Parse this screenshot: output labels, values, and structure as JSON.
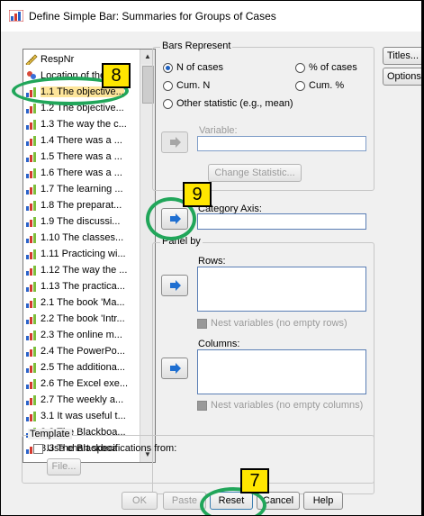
{
  "window": {
    "title": "Define Simple Bar: Summaries for Groups of Cases"
  },
  "variables": [
    {
      "label": "RespNr",
      "icon": "ruler-icon"
    },
    {
      "label": "Location of the st",
      "icon": "nominal-icon"
    },
    {
      "label": "1.1 The objective...",
      "icon": "bar-icon",
      "selected": true
    },
    {
      "label": "1.2 The objective...",
      "icon": "bar-icon"
    },
    {
      "label": "1.3 The way the c...",
      "icon": "bar-icon"
    },
    {
      "label": "1.4 There was a ...",
      "icon": "bar-icon"
    },
    {
      "label": "1.5 There was a ...",
      "icon": "bar-icon"
    },
    {
      "label": "1.6 There was a ...",
      "icon": "bar-icon"
    },
    {
      "label": "1.7 The learning ...",
      "icon": "bar-icon"
    },
    {
      "label": "1.8 The preparat...",
      "icon": "bar-icon"
    },
    {
      "label": "1.9 The discussi...",
      "icon": "bar-icon"
    },
    {
      "label": "1.10 The classes...",
      "icon": "bar-icon"
    },
    {
      "label": "1.11 Practicing wi...",
      "icon": "bar-icon"
    },
    {
      "label": "1.12 The way the ...",
      "icon": "bar-icon"
    },
    {
      "label": "1.13 The practica...",
      "icon": "bar-icon"
    },
    {
      "label": "2.1 The book 'Ma...",
      "icon": "bar-icon"
    },
    {
      "label": "2.2 The book 'Intr...",
      "icon": "bar-icon"
    },
    {
      "label": "2.3 The online m...",
      "icon": "bar-icon"
    },
    {
      "label": "2.4 The PowerPo...",
      "icon": "bar-icon"
    },
    {
      "label": "2.5 The additiona...",
      "icon": "bar-icon"
    },
    {
      "label": "2.6 The Excel exe...",
      "icon": "bar-icon"
    },
    {
      "label": "2.7 The weekly a...",
      "icon": "bar-icon"
    },
    {
      "label": "3.1 It was useful t...",
      "icon": "bar-icon"
    },
    {
      "label": "3.2 The Blackboa...",
      "icon": "bar-icon"
    },
    {
      "label": "3.3 The Blackboa",
      "icon": "bar-icon"
    }
  ],
  "bars_represent": {
    "legend": "Bars Represent",
    "n_cases": "N of cases",
    "pct_cases": "% of cases",
    "cum_n": "Cum. N",
    "cum_pct": "Cum. %",
    "other": "Other statistic (e.g., mean)",
    "selected": "n_cases",
    "variable_label": "Variable:",
    "change_statistic": "Change Statistic..."
  },
  "category_axis": {
    "label": "Category Axis:",
    "value": ""
  },
  "panel_by": {
    "legend": "Panel by",
    "rows_label": "Rows:",
    "nest_rows": "Nest variables (no empty rows)",
    "columns_label": "Columns:",
    "nest_columns": "Nest variables (no empty columns)"
  },
  "side_buttons": {
    "titles": "Titles...",
    "options": "Options..."
  },
  "template": {
    "legend": "Template",
    "use_spec": "Use chart specifications from:",
    "file": "File..."
  },
  "footer": {
    "ok": "OK",
    "paste": "Paste",
    "reset": "Reset",
    "cancel": "Cancel",
    "help": "Help"
  },
  "annotations": {
    "badge_8": "8",
    "badge_9": "9",
    "badge_7": "7",
    "highlight_color": "#21a65a",
    "badge_color": "#ffe600"
  },
  "colors": {
    "arrow": "#1f6fd1",
    "field_border": "#5a7eb5"
  }
}
